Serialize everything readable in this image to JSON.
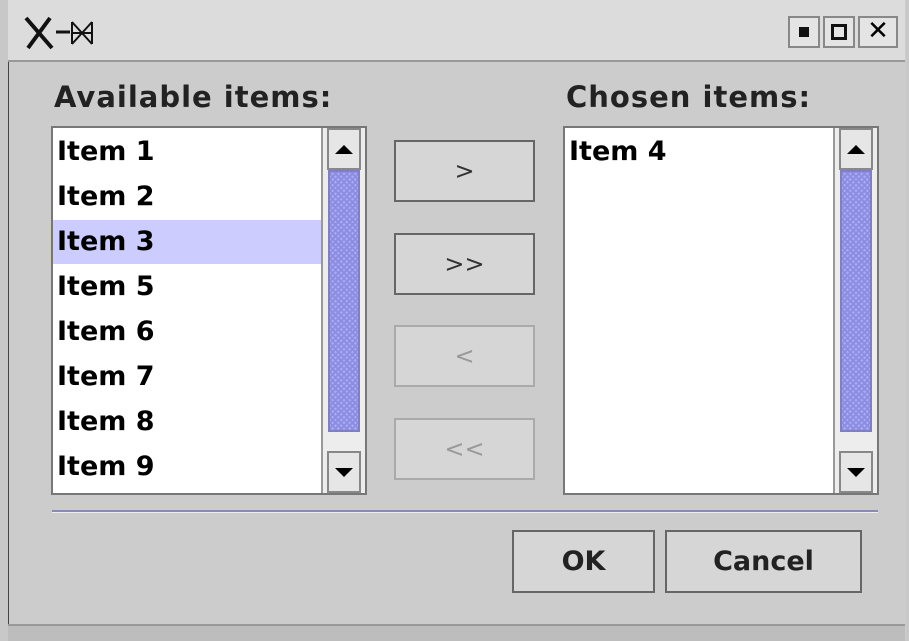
{
  "window": {
    "title_icon": "x-window-logo-icon",
    "controls": [
      "minimize-icon",
      "maximize-icon",
      "close-icon"
    ],
    "close_glyph": "✕"
  },
  "available": {
    "label": "Available items:",
    "items": [
      {
        "label": "Item 1",
        "selected": false
      },
      {
        "label": "Item 2",
        "selected": false
      },
      {
        "label": "Item 3",
        "selected": true
      },
      {
        "label": "Item 5",
        "selected": false
      },
      {
        "label": "Item 6",
        "selected": false
      },
      {
        "label": "Item 7",
        "selected": false
      },
      {
        "label": "Item 8",
        "selected": false
      },
      {
        "label": "Item 9",
        "selected": false
      }
    ]
  },
  "chosen": {
    "label": "Chosen items:",
    "items": [
      {
        "label": "Item 4",
        "selected": false
      }
    ]
  },
  "transfer": {
    "add_one": {
      "label": ">",
      "enabled": true
    },
    "add_all": {
      "label": ">>",
      "enabled": true
    },
    "remove_one": {
      "label": "<",
      "enabled": false
    },
    "remove_all": {
      "label": "<<",
      "enabled": false
    }
  },
  "actions": {
    "ok": "OK",
    "cancel": "Cancel"
  },
  "colors": {
    "selection": "#ccccff",
    "scroll_thumb": "#aaaaff",
    "separator": "#8a8ab8"
  }
}
